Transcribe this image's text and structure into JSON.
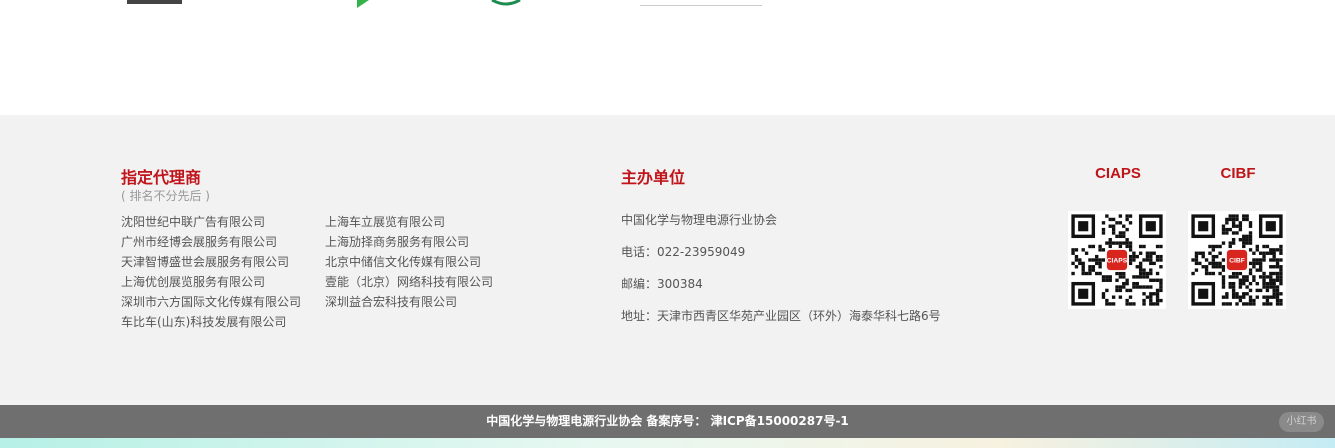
{
  "top_logos": [
    {
      "name": "partner-logo-1"
    },
    {
      "name": "partner-logo-2"
    },
    {
      "name": "partner-logo-3"
    },
    {
      "name": "partner-logo-4"
    }
  ],
  "agents": {
    "title": "指定代理商",
    "note": "( 排名不分先后 )",
    "col1": [
      "沈阳世纪中联广告有限公司",
      "广州市经博会展服务有限公司",
      "天津智博盛世会展服务有限公司",
      "上海优创展览服务有限公司",
      "深圳市六方国际文化传媒有限公司",
      "车比车(山东)科技发展有限公司"
    ],
    "col2": [
      "上海车立展览有限公司",
      "上海劢择商务服务有限公司",
      "北京中储信文化传媒有限公司",
      "壹能（北京）网络科技有限公司",
      "深圳益合宏科技有限公司"
    ]
  },
  "organizer": {
    "title": "主办单位",
    "name": "中国化学与物理电源行业协会",
    "phone": "电话：022-23959049",
    "postcode": "邮编：300384",
    "address": "地址：天津市西青区华苑产业园区（环外）海泰华科七路6号"
  },
  "qrcodes": [
    {
      "title": "CIAPS",
      "badge": "CIAPS",
      "color": "#d8261f"
    },
    {
      "title": "CIBF",
      "badge": "CIBF",
      "color": "#d8261f"
    }
  ],
  "footer": {
    "icp_text": "中国化学与物理电源行业协会 备案序号： 津ICP备15000287号-1",
    "widget_label": "小红书"
  },
  "colors": {
    "accent": "#c0141b",
    "footer_bg": "#f2f2f2",
    "bar_bg": "#6f6f6f"
  }
}
